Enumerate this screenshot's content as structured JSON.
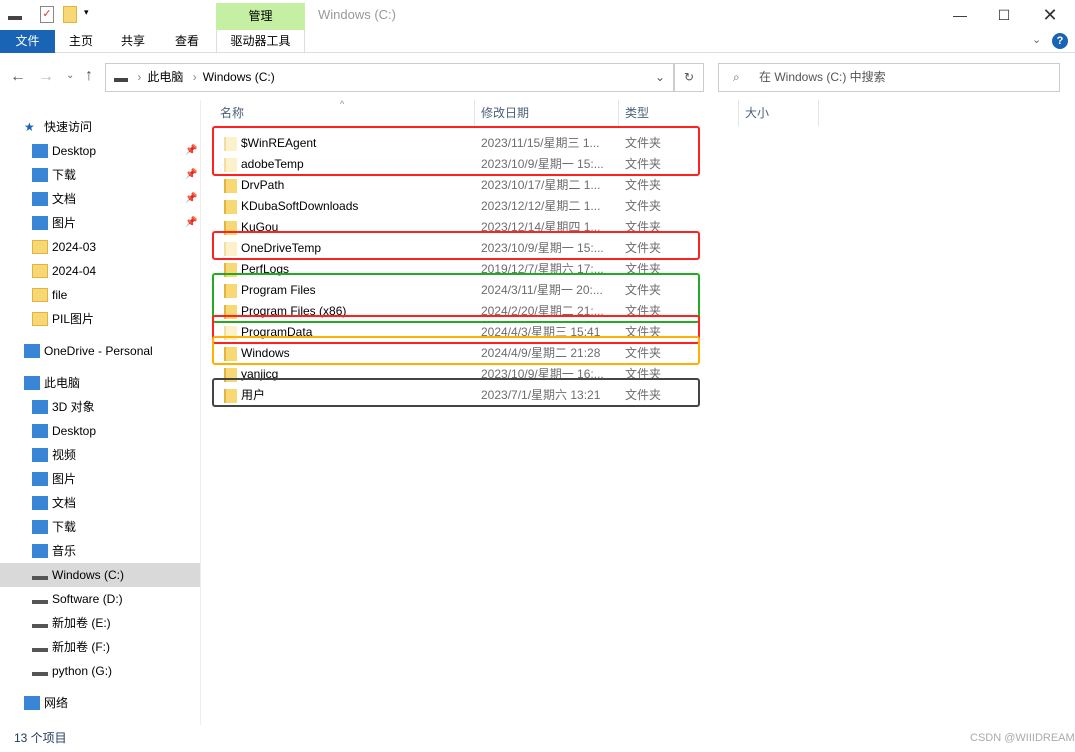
{
  "window": {
    "title": "Windows (C:)",
    "context_tab": "管理"
  },
  "ribbon": {
    "tabs": [
      "文件",
      "主页",
      "共享",
      "查看",
      "驱动器工具"
    ]
  },
  "address": {
    "crumbs": [
      "此电脑",
      "Windows (C:)"
    ]
  },
  "search": {
    "placeholder": "在 Windows (C:) 中搜索"
  },
  "nav": [
    {
      "label": "快速访问",
      "icon": "star-icon",
      "indent": 0
    },
    {
      "label": "Desktop",
      "icon": "desktop-icon",
      "indent": 1,
      "pinned": true
    },
    {
      "label": "下载",
      "icon": "download-icon",
      "indent": 1,
      "pinned": true
    },
    {
      "label": "文档",
      "icon": "document-icon",
      "indent": 1,
      "pinned": true
    },
    {
      "label": "图片",
      "icon": "picture-icon",
      "indent": 1,
      "pinned": true
    },
    {
      "label": "2024-03",
      "icon": "folder-icon",
      "indent": 1
    },
    {
      "label": "2024-04",
      "icon": "folder-icon",
      "indent": 1
    },
    {
      "label": "file",
      "icon": "folder-icon",
      "indent": 1
    },
    {
      "label": "PIL图片",
      "icon": "folder-icon",
      "indent": 1
    },
    {
      "label": "OneDrive - Personal",
      "icon": "cloud-icon",
      "indent": 0,
      "gap": true
    },
    {
      "label": "此电脑",
      "icon": "computer-icon",
      "indent": 0,
      "gap": true
    },
    {
      "label": "3D 对象",
      "icon": "cube-icon",
      "indent": 1
    },
    {
      "label": "Desktop",
      "icon": "desktop-icon",
      "indent": 1
    },
    {
      "label": "视频",
      "icon": "video-icon",
      "indent": 1
    },
    {
      "label": "图片",
      "icon": "picture-icon",
      "indent": 1
    },
    {
      "label": "文档",
      "icon": "document-icon",
      "indent": 1
    },
    {
      "label": "下载",
      "icon": "download-icon",
      "indent": 1
    },
    {
      "label": "音乐",
      "icon": "music-icon",
      "indent": 1
    },
    {
      "label": "Windows (C:)",
      "icon": "drive-icon",
      "indent": 1,
      "selected": true
    },
    {
      "label": "Software (D:)",
      "icon": "drive-icon",
      "indent": 1
    },
    {
      "label": "新加卷 (E:)",
      "icon": "drive-icon",
      "indent": 1
    },
    {
      "label": "新加卷 (F:)",
      "icon": "drive-icon",
      "indent": 1
    },
    {
      "label": "python (G:)",
      "icon": "drive-icon",
      "indent": 1
    },
    {
      "label": "网络",
      "icon": "network-icon",
      "indent": 0,
      "gap": true
    }
  ],
  "columns": [
    "名称",
    "修改日期",
    "类型",
    "大小"
  ],
  "files": [
    {
      "name": "$WinREAgent",
      "date": "2023/11/15/星期三 1...",
      "type": "文件夹",
      "hidden": true
    },
    {
      "name": "adobeTemp",
      "date": "2023/10/9/星期一 15:...",
      "type": "文件夹",
      "hidden": true
    },
    {
      "name": "DrvPath",
      "date": "2023/10/17/星期二 1...",
      "type": "文件夹"
    },
    {
      "name": "KDubaSoftDownloads",
      "date": "2023/12/12/星期二 1...",
      "type": "文件夹"
    },
    {
      "name": "KuGou",
      "date": "2023/12/14/星期四 1...",
      "type": "文件夹"
    },
    {
      "name": "OneDriveTemp",
      "date": "2023/10/9/星期一 15:...",
      "type": "文件夹",
      "hidden": true
    },
    {
      "name": "PerfLogs",
      "date": "2019/12/7/星期六 17:...",
      "type": "文件夹"
    },
    {
      "name": "Program Files",
      "date": "2024/3/11/星期一 20:...",
      "type": "文件夹"
    },
    {
      "name": "Program Files (x86)",
      "date": "2024/2/20/星期二 21:...",
      "type": "文件夹"
    },
    {
      "name": "ProgramData",
      "date": "2024/4/3/星期三 15:41",
      "type": "文件夹",
      "hidden": true
    },
    {
      "name": "Windows",
      "date": "2024/4/9/星期二 21:28",
      "type": "文件夹"
    },
    {
      "name": "yanjicg",
      "date": "2023/10/9/星期一 16:...",
      "type": "文件夹"
    },
    {
      "name": "用户",
      "date": "2023/7/1/星期六 13:21",
      "type": "文件夹"
    }
  ],
  "highlights": [
    {
      "rows": [
        0,
        1
      ],
      "color": "#ff2020"
    },
    {
      "rows": [
        5,
        5
      ],
      "color": "#ff2020"
    },
    {
      "rows": [
        7,
        8
      ],
      "color": "#22aa22"
    },
    {
      "rows": [
        9,
        9
      ],
      "color": "#ff2020"
    },
    {
      "rows": [
        10,
        10
      ],
      "color": "#ffb000"
    },
    {
      "rows": [
        12,
        12
      ],
      "color": "#444444"
    }
  ],
  "status": {
    "count": "13 个项目"
  },
  "watermark": "CSDN @WIIIDREAM"
}
